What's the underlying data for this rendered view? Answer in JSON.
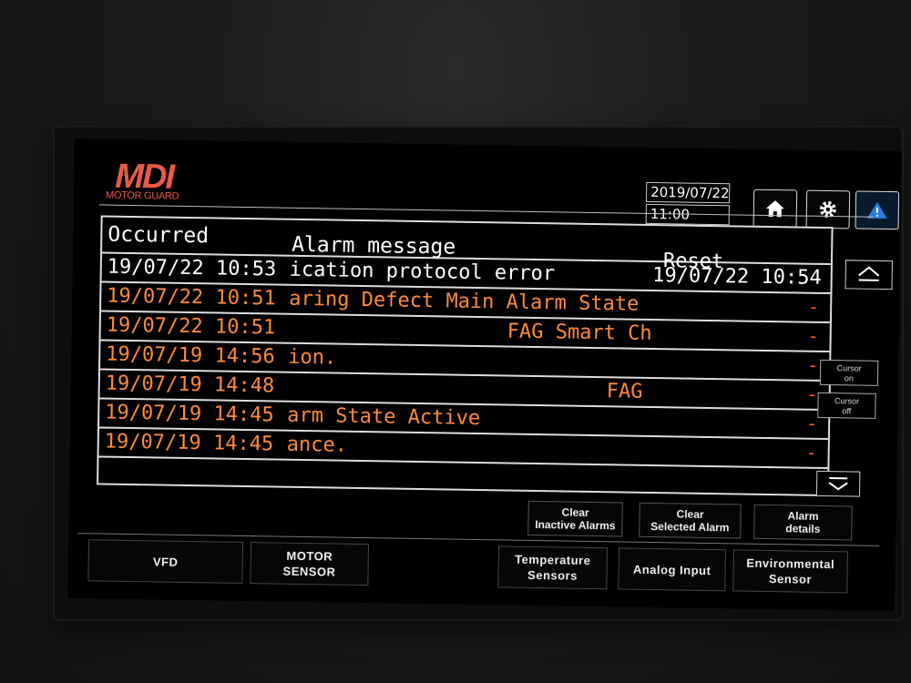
{
  "brand": {
    "logo": "MDI",
    "tagline": "MOTOR GUARD"
  },
  "datetime": {
    "date": "2019/07/22",
    "time": "11:00"
  },
  "top_buttons": {
    "home": "home-icon",
    "settings": "gear-icon",
    "alarm": "warning-icon"
  },
  "table": {
    "headers": {
      "occurred": "Occurred",
      "message": "Alarm message",
      "reset": "Reset"
    },
    "rows": [
      {
        "time": "19/07/22 10:53",
        "message": "ication protocol error",
        "reset": "19/07/22 10:54",
        "state": "inactive"
      },
      {
        "time": "19/07/22 10:51",
        "message": "aring Defect Main Alarm State",
        "reset": "-",
        "state": "active"
      },
      {
        "time": "19/07/22 10:51",
        "message": "FAG Smart Ch",
        "reset": "-",
        "state": "active"
      },
      {
        "time": "19/07/19 14:56",
        "message": "ion.",
        "reset": "-",
        "state": "active"
      },
      {
        "time": "19/07/19 14:48",
        "message": "FAG",
        "reset": "-",
        "state": "active"
      },
      {
        "time": "19/07/19 14:45",
        "message": "arm State Active",
        "reset": "-",
        "state": "active"
      },
      {
        "time": "19/07/19 14:45",
        "message": "ance.",
        "reset": "-",
        "state": "active"
      }
    ]
  },
  "side": {
    "cursor_on": {
      "line1": "Cursor",
      "line2": "on"
    },
    "cursor_off": {
      "line1": "Cursor",
      "line2": "off"
    }
  },
  "actions": {
    "clear_inactive": {
      "line1": "Clear",
      "line2": "Inactive Alarms"
    },
    "clear_selected": {
      "line1": "Clear",
      "line2": "Selected Alarm"
    },
    "alarm_details": {
      "line1": "Alarm",
      "line2": "details"
    }
  },
  "nav": {
    "vfd": "VFD",
    "motor_sensor": {
      "line1": "MOTOR",
      "line2": "SENSOR"
    },
    "temperature": {
      "line1": "Temperature",
      "line2": "Sensors"
    },
    "analog": "Analog Input",
    "environmental": {
      "line1": "Environmental",
      "line2": "Sensor"
    }
  },
  "colors": {
    "active_alarm": "#ff8a3c",
    "inactive_alarm": "#ffffff",
    "logo": "#e85a4a"
  }
}
